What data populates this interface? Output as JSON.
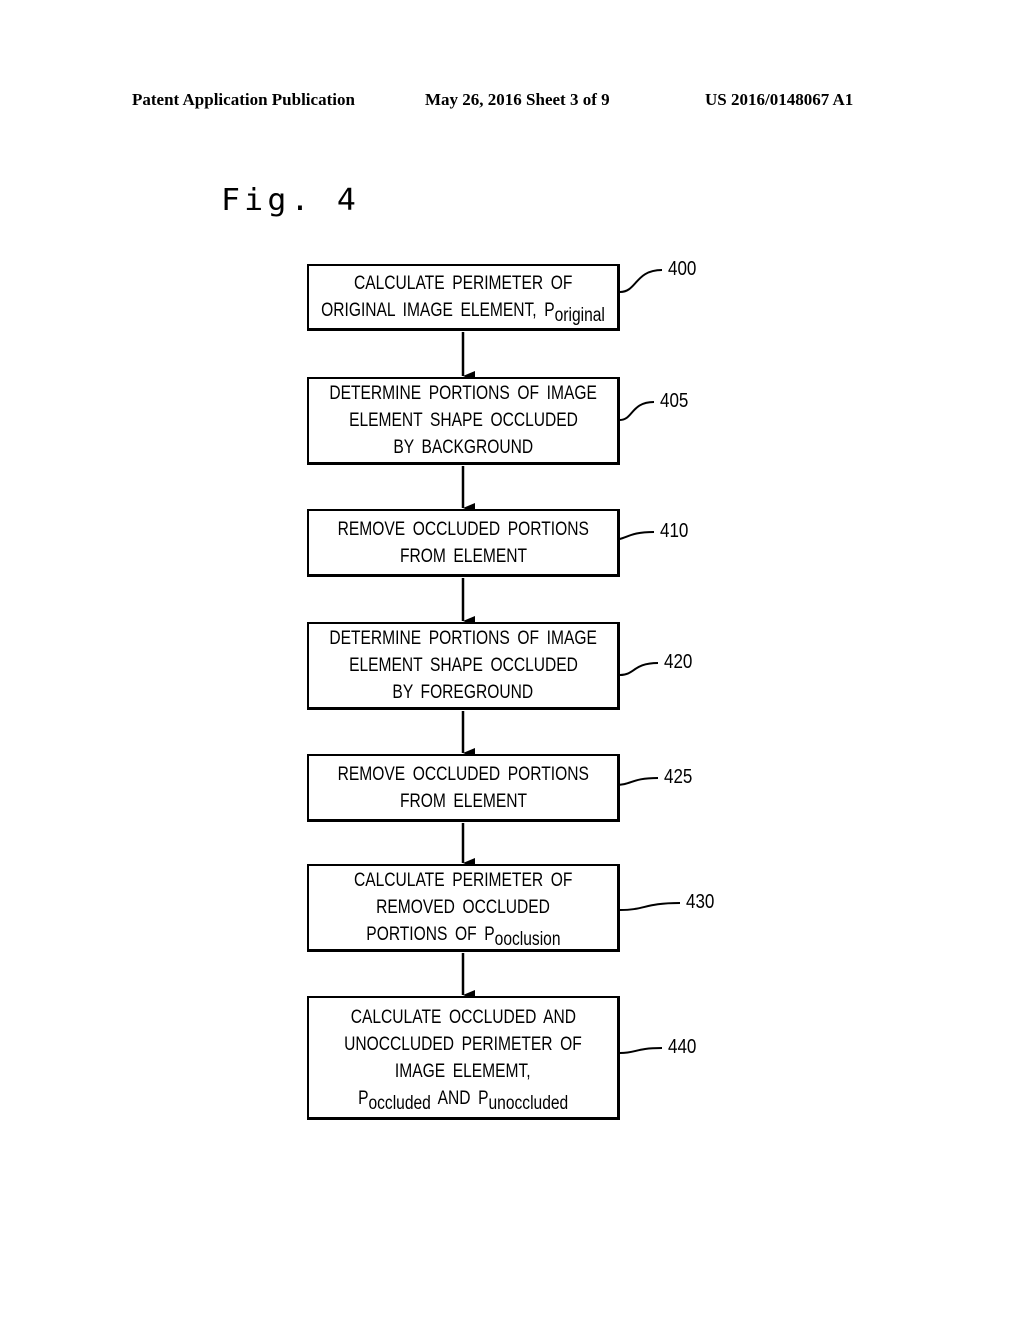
{
  "header": {
    "left": "Patent Application Publication",
    "middle": "May 26, 2016  Sheet 3 of 9",
    "right": "US 2016/0148067 A1"
  },
  "figure": {
    "label": "Fig. 4",
    "steps": [
      {
        "ref": "400",
        "lines": [
          "CALCULATE PERIMETER OF"
        ],
        "last": {
          "pre": "ORIGINAL IMAGE ELEMENT, P",
          "sub": "original",
          "post": ""
        }
      },
      {
        "ref": "405",
        "lines": [
          "DETERMINE PORTIONS OF IMAGE",
          "ELEMENT SHAPE OCCLUDED",
          "BY BACKGROUND"
        ]
      },
      {
        "ref": "410",
        "lines": [
          "REMOVE OCCLUDED PORTIONS",
          "FROM ELEMENT"
        ]
      },
      {
        "ref": "420",
        "lines": [
          "DETERMINE PORTIONS OF IMAGE",
          "ELEMENT SHAPE OCCLUDED",
          "BY FOREGROUND"
        ]
      },
      {
        "ref": "425",
        "lines": [
          "REMOVE OCCLUDED PORTIONS",
          "FROM ELEMENT"
        ]
      },
      {
        "ref": "430",
        "lines": [
          "CALCULATE PERIMETER OF",
          "REMOVED OCCLUDED"
        ],
        "last": {
          "pre": "PORTIONS OF P",
          "sub": "ooclusion",
          "post": ""
        }
      },
      {
        "ref": "440",
        "lines": [
          "CALCULATE OCCLUDED AND",
          "UNOCCLUDED PERIMETER OF",
          "IMAGE ELEMEMT,"
        ],
        "last": {
          "pre": "P",
          "sub": "occluded",
          "mid": " AND P",
          "sub2": "unoccluded"
        }
      }
    ]
  }
}
